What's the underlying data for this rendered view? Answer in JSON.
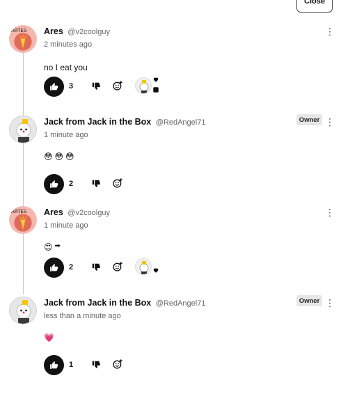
{
  "header": {
    "close_label": "Close"
  },
  "comments": [
    {
      "author": "Ares",
      "handle": "@v2coolguy",
      "time": "2 minutes ago",
      "text": "no I eat you",
      "likes": "3",
      "owner": false,
      "avatar": "ares-avatar",
      "reactions": [
        "jack-mini-avatar",
        "heart"
      ]
    },
    {
      "author": "Jack from Jack in the Box",
      "handle": "@RedAngel71",
      "time": "1 minute ago",
      "text": "",
      "emojis": [
        "😳",
        "😳",
        "😳"
      ],
      "likes": "2",
      "owner": true,
      "owner_label": "Owner",
      "avatar": "jack-avatar"
    },
    {
      "author": "Ares",
      "handle": "@v2coolguy",
      "time": "1 minute ago",
      "text": "",
      "emojis": [
        "😍",
        "➡"
      ],
      "likes": "2",
      "owner": false,
      "avatar": "ares-avatar",
      "reactions": [
        "jack-mini-avatar",
        "heart"
      ]
    },
    {
      "author": "Jack from Jack in the Box",
      "handle": "@RedAngel71",
      "time": "less than a minute ago",
      "text": "",
      "emojis": [
        "💗"
      ],
      "likes": "1",
      "owner": true,
      "owner_label": "Owner",
      "avatar": "jack-avatar"
    }
  ],
  "colors": {
    "like_bg": "#111111",
    "badge_bg": "#e6e6e6",
    "thread_line": "#c9c9c9"
  }
}
